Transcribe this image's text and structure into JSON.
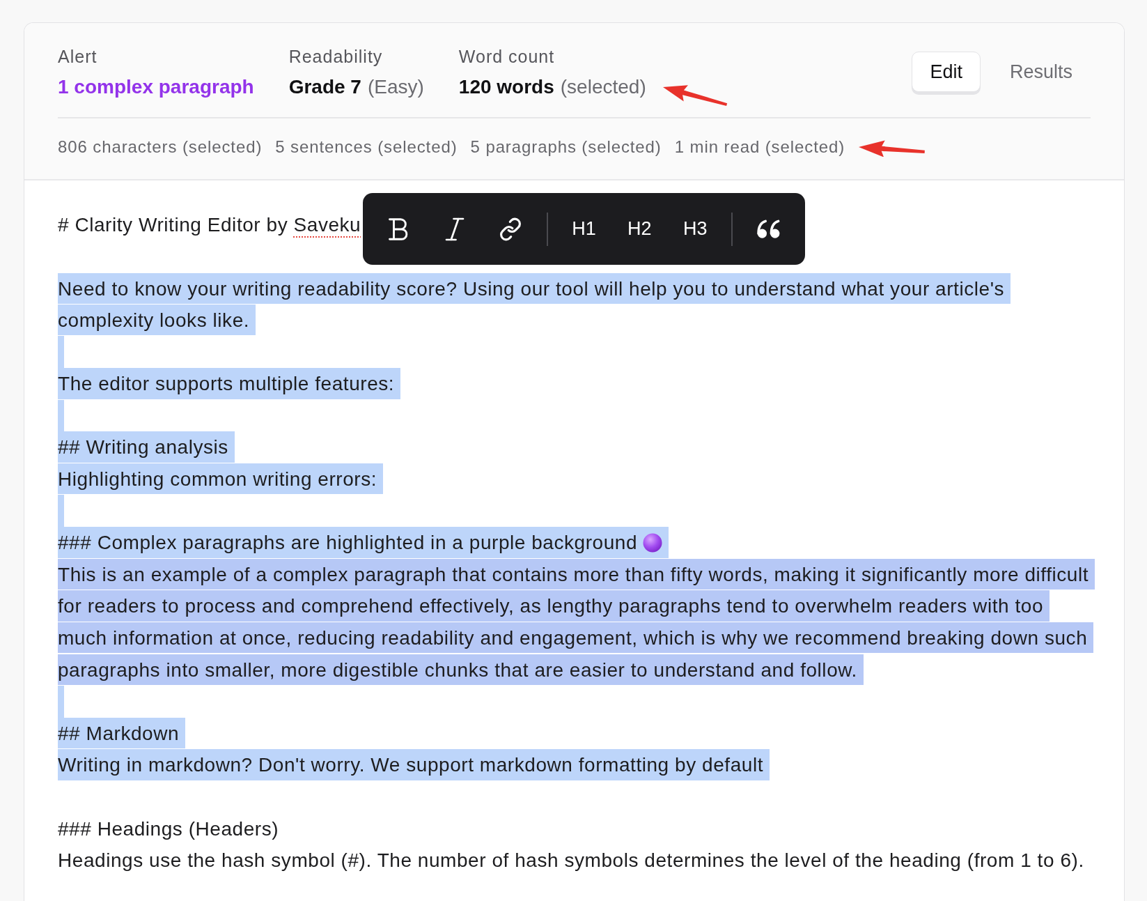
{
  "header": {
    "metrics": [
      {
        "kind": "alert",
        "label": "Alert",
        "value": "1 complex paragraph"
      },
      {
        "kind": "stat",
        "label": "Readability",
        "value": "Grade 7",
        "note": "(Easy)"
      },
      {
        "kind": "stat",
        "label": "Word count",
        "value": "120 words",
        "note": "(selected)"
      }
    ],
    "tabs": [
      {
        "label": "Edit",
        "selected": true
      },
      {
        "label": "Results",
        "selected": false
      }
    ],
    "stats": [
      "806 characters (selected)",
      "5 sentences (selected)",
      "5 paragraphs (selected)",
      "1 min read (selected)"
    ]
  },
  "toolbar": {
    "groups": [
      [
        {
          "kind": "bold"
        },
        {
          "kind": "italic"
        },
        {
          "kind": "link"
        }
      ],
      [
        {
          "kind": "heading",
          "label": "H1"
        },
        {
          "kind": "heading",
          "label": "H2"
        },
        {
          "kind": "heading",
          "label": "H3"
        }
      ],
      [
        {
          "kind": "quote"
        }
      ]
    ]
  },
  "editor": {
    "blocks": [
      {
        "kind": "text",
        "selected": false,
        "complex": false,
        "lines": [
          "# Clarity Writing Editor by "
        ],
        "misspelled_word": "Saveku"
      },
      {
        "kind": "blank",
        "selected": false
      },
      {
        "kind": "text",
        "selected": true,
        "complex": false,
        "lines": [
          "Need to know your writing readability score? Using our tool will help you to understand what your article's",
          "complexity looks like."
        ]
      },
      {
        "kind": "blank",
        "selected": true
      },
      {
        "kind": "text",
        "selected": true,
        "complex": false,
        "lines": [
          "The editor supports multiple features:"
        ]
      },
      {
        "kind": "blank",
        "selected": true
      },
      {
        "kind": "text",
        "selected": true,
        "complex": false,
        "lines": [
          "## Writing analysis"
        ]
      },
      {
        "kind": "text",
        "selected": true,
        "complex": false,
        "lines": [
          "Highlighting common writing errors:"
        ]
      },
      {
        "kind": "blank",
        "selected": true
      },
      {
        "kind": "emojiline",
        "selected": true,
        "complex": false,
        "lines": [
          "### Complex paragraphs are highlighted in a purple background"
        ]
      },
      {
        "kind": "text",
        "selected": true,
        "complex": true,
        "lines": [
          "This is an example of a complex paragraph that contains more than fifty words, making it significantly more difficult",
          "for readers to process and comprehend effectively, as lengthy paragraphs tend to overwhelm readers with too",
          "much information at once, reducing readability and engagement, which is why we recommend breaking down such",
          "paragraphs into smaller, more digestible chunks that are easier to understand and follow."
        ]
      },
      {
        "kind": "blank",
        "selected": true
      },
      {
        "kind": "text",
        "selected": true,
        "complex": false,
        "lines": [
          "## Markdown"
        ]
      },
      {
        "kind": "text",
        "selected": true,
        "complex": false,
        "lines": [
          "Writing in markdown? Don't worry. We support markdown formatting by default"
        ]
      },
      {
        "kind": "blank",
        "selected": false
      },
      {
        "kind": "text",
        "selected": false,
        "complex": false,
        "lines": [
          "### Headings (Headers)"
        ]
      },
      {
        "kind": "text",
        "selected": false,
        "complex": false,
        "lines": [
          "Headings use the hash symbol (#). The number of hash symbols determines the level of the heading (from 1 to 6)."
        ]
      }
    ]
  }
}
